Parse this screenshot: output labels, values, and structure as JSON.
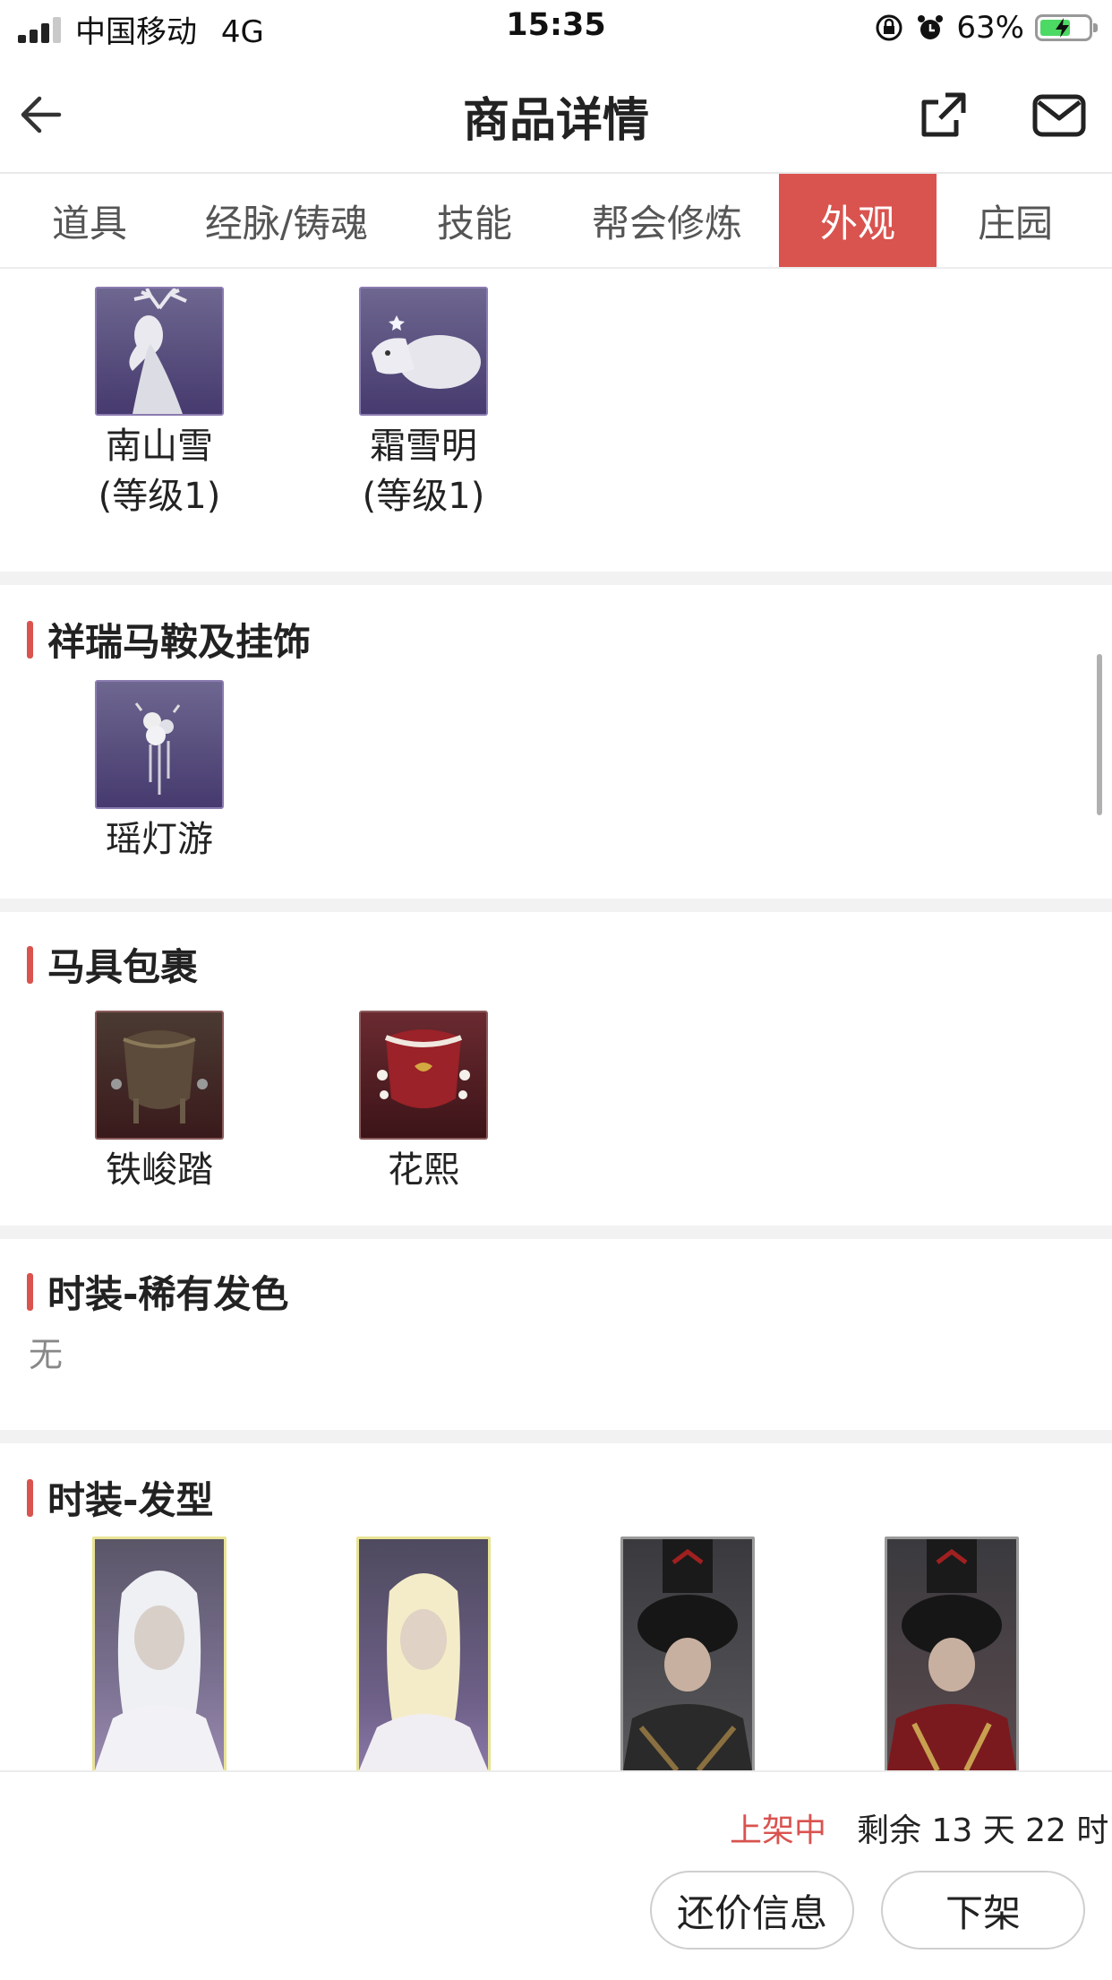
{
  "status_bar": {
    "carrier": "中国移动",
    "network": "4G",
    "time": "15:35",
    "battery": "63%"
  },
  "nav": {
    "title": "商品详情",
    "back_icon": "arrow-left-icon",
    "share_icon": "share-icon",
    "message_icon": "mail-icon"
  },
  "tabs": [
    {
      "label": "道具"
    },
    {
      "label": "经脉/铸魂"
    },
    {
      "label": "技能"
    },
    {
      "label": "帮会修炼"
    },
    {
      "label": "外观",
      "active": true
    },
    {
      "label": "庄园"
    }
  ],
  "mounts_partial": {
    "items": [
      {
        "name": "南山雪",
        "level": "(等级1)"
      },
      {
        "name": "霜雪明",
        "level": "(等级1)"
      }
    ]
  },
  "sections": {
    "saddle": {
      "title": "祥瑞马鞍及挂饰",
      "items": [
        {
          "name": "瑶灯游"
        }
      ]
    },
    "harness": {
      "title": "马具包裹",
      "items": [
        {
          "name": "铁峻踏"
        },
        {
          "name": "花熙"
        }
      ]
    },
    "rare_hair_color": {
      "title": "时装-稀有发色",
      "empty_text": "无"
    },
    "hairstyle": {
      "title": "时装-发型"
    }
  },
  "bottom": {
    "status": "上架中",
    "remaining": "剩余 13 天 22 时",
    "bargain_button": "还价信息",
    "delist_button": "下架"
  },
  "colors": {
    "accent": "#d9534f",
    "separator": "#f2f2f2"
  }
}
